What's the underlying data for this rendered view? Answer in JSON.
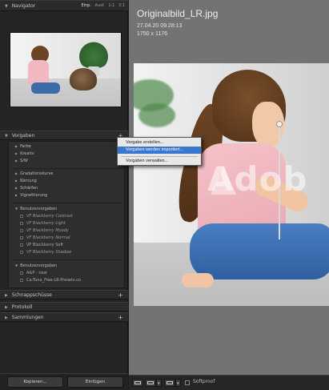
{
  "navigator": {
    "title": "Navigator",
    "zoom_options": [
      "Einp.",
      "Ausf.",
      "1:1",
      "3:1"
    ]
  },
  "presets": {
    "title": "Vorgaben",
    "groups": [
      {
        "label": "Farbe"
      },
      {
        "label": "Kreativ"
      },
      {
        "label": "S/W"
      },
      {
        "label": "Gradationskurve"
      },
      {
        "label": "Körnung"
      },
      {
        "label": "Schärfen"
      },
      {
        "label": "Vignettierung"
      }
    ],
    "user_group": {
      "label": "Benutzervorgaben",
      "items": [
        {
          "label": "VF Blackberry Contrast",
          "italic": true
        },
        {
          "label": "VF Blackberry Light",
          "italic": true
        },
        {
          "label": "VF Blackberry Moody",
          "italic": true
        },
        {
          "label": "VF Blackberry Normal",
          "italic": true
        },
        {
          "label": "VF Blackberry Soft",
          "italic": false
        },
        {
          "label": "VF Blackberry Shadow",
          "italic": true
        }
      ]
    },
    "user_group2": {
      "label": "Benutzervorgaben",
      "items": [
        {
          "label": "A&P - new"
        },
        {
          "label": "Ca-Tuna_Free-LR-Presets.co"
        }
      ]
    }
  },
  "snapshots": {
    "title": "Schnappschüsse"
  },
  "history": {
    "title": "Protokoll"
  },
  "collections": {
    "title": "Sammlungen"
  },
  "bottom_buttons": {
    "copy": "Kopieren...",
    "paste": "Einfügen"
  },
  "context_menu": {
    "items": [
      {
        "label": "Vorgabe erstellen...",
        "active": false
      },
      {
        "label": "Vorgaben werden importiert...",
        "active": true
      },
      {
        "label": "Vorgaben verwalten...",
        "active": false
      }
    ]
  },
  "photo": {
    "filename": "Originalbild_LR.jpg",
    "date": "27.04.20 09:28:13",
    "dimensions": "1750 x 1176",
    "watermark": "Adob"
  },
  "toolbar": {
    "softproof_label": "Softproof"
  },
  "colors": {
    "menu_highlight": "#3b76d1",
    "panel_bg": "#242424",
    "main_bg": "#737373"
  }
}
